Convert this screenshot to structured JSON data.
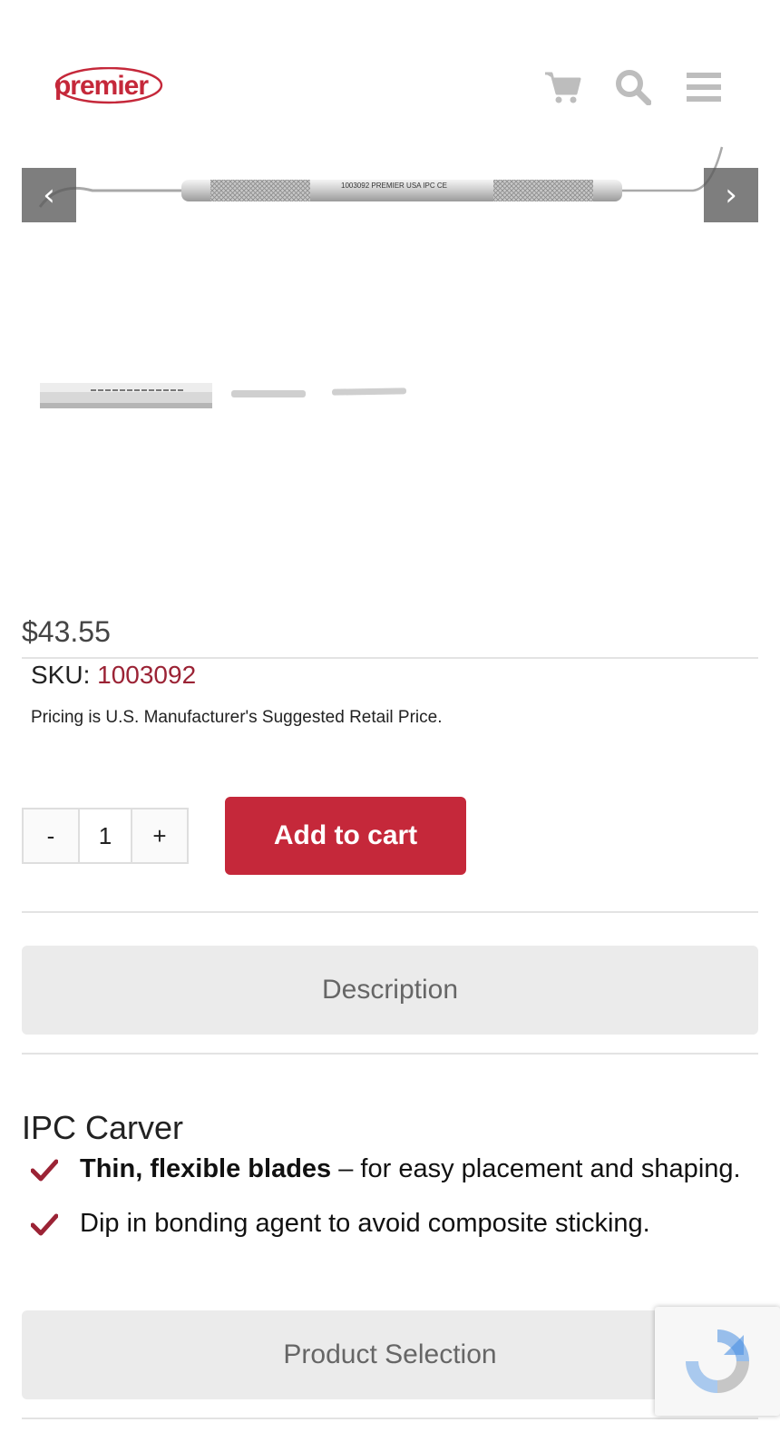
{
  "header": {
    "logo_text": "premier",
    "icons": [
      "cart-icon",
      "search-icon",
      "menu-icon"
    ]
  },
  "slider": {
    "prev_label": "‹",
    "next_label": "›",
    "engraving": "1003092 PREMIER USA IPC CE",
    "thumbnail_count": 3
  },
  "product": {
    "price": "$43.55",
    "sku_label": "SKU:",
    "sku_value": "1003092",
    "pricing_note": "Pricing is U.S. Manufacturer's Suggested Retail Price.",
    "title": "IPC Carver",
    "bullets": [
      {
        "bold": "Thin, flexible blades",
        "text": " – for easy placement and shaping."
      },
      {
        "bold": "",
        "text": "Dip in bonding agent to avoid composite sticking."
      }
    ]
  },
  "cart": {
    "minus": "-",
    "qty": "1",
    "plus": "+",
    "add_label": "Add to cart"
  },
  "tabs": {
    "description": "Description",
    "product_selection": "Product Selection"
  },
  "colors": {
    "brand_red": "#c5283a",
    "sku_red": "#9b2335",
    "icon_gray": "#bdbdbd"
  }
}
